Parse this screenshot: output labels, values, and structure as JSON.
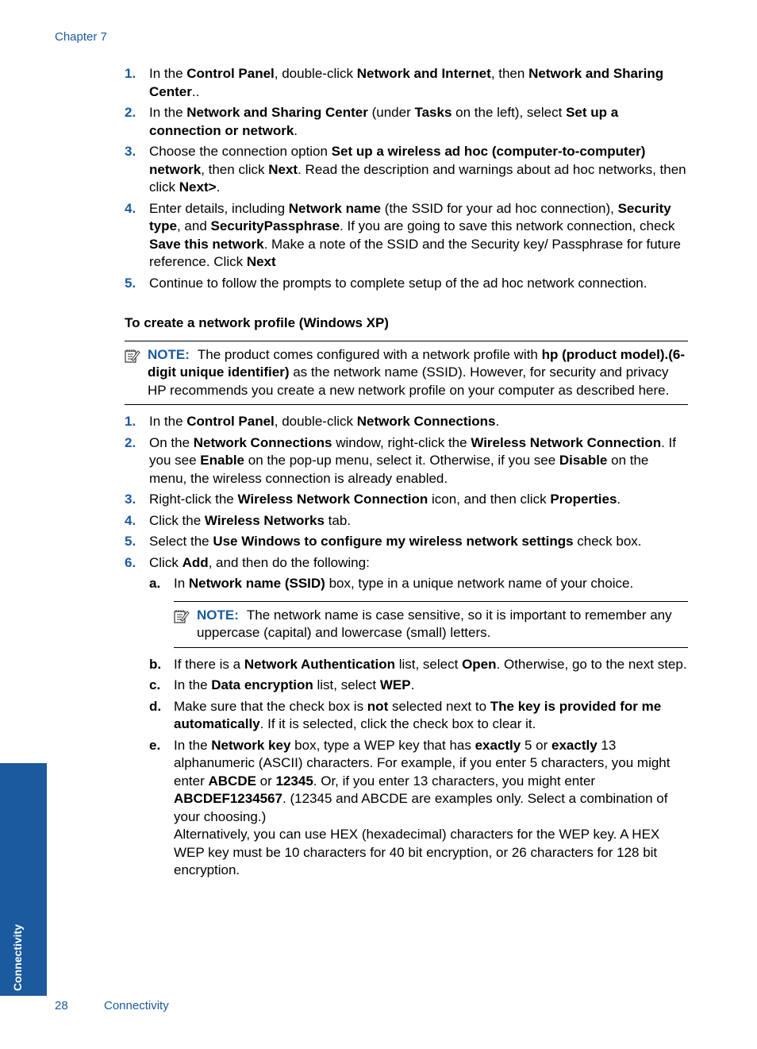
{
  "header": {
    "chapter": "Chapter 7"
  },
  "steps_a": [
    {
      "n": "1.",
      "html": "In the <b>Control Panel</b>, double-click <b>Network and Internet</b>, then <b>Network and Sharing Center</b>.."
    },
    {
      "n": "2.",
      "html": "In the <b>Network and Sharing Center</b> (under <b>Tasks</b> on the left), select <b>Set up a connection or network</b>."
    },
    {
      "n": "3.",
      "html": "Choose the connection option <b>Set up a wireless ad hoc (computer-to-computer) network</b>, then click <b>Next</b>. Read the description and warnings about ad hoc networks, then click <b>Next&gt;</b>."
    },
    {
      "n": "4.",
      "html": "Enter details, including <b>Network name</b> (the SSID for your ad hoc connection), <b>Security type</b>, and <b>SecurityPassphrase</b>. If you are going to save this network connection, check <b>Save this network</b>. Make a note of the SSID and the Security key/ Passphrase for future reference. Click <b>Next</b>"
    },
    {
      "n": "5.",
      "html": "Continue to follow the prompts to complete setup of the ad hoc network connection."
    }
  ],
  "section_heading": "To create a network profile (Windows XP)",
  "note1": {
    "label": "NOTE:",
    "html": "The product comes configured with a network profile with <b>hp (product model).(6-digit unique identifier)</b> as the network name (SSID). However, for security and privacy HP recommends you create a new network profile on your computer as described here."
  },
  "steps_b": [
    {
      "n": "1.",
      "html": "In the <b>Control Panel</b>, double-click <b>Network Connections</b>."
    },
    {
      "n": "2.",
      "html": "On the <b>Network Connections</b> window, right-click the <b>Wireless Network Connection</b>. If you see <b>Enable</b> on the pop-up menu, select it. Otherwise, if you see <b>Disable</b> on the menu, the wireless connection is already enabled."
    },
    {
      "n": "3.",
      "html": "Right-click the <b>Wireless Network Connection</b> icon, and then click <b>Properties</b>."
    },
    {
      "n": "4.",
      "html": "Click the <b>Wireless Networks</b> tab."
    },
    {
      "n": "5.",
      "html": "Select the <b>Use Windows to configure my wireless network settings</b> check box."
    },
    {
      "n": "6.",
      "html": "Click <b>Add</b>, and then do the following:"
    }
  ],
  "substeps": [
    {
      "l": "a.",
      "html": "In <b>Network name (SSID)</b> box, type in a unique network name of your choice."
    },
    {
      "l": "b.",
      "html": "If there is a <b>Network Authentication</b> list, select <b>Open</b>. Otherwise, go to the next step."
    },
    {
      "l": "c.",
      "html": "In the <b>Data encryption</b> list, select <b>WEP</b>."
    },
    {
      "l": "d.",
      "html": "Make sure that the check box is <b>not</b> selected next to <b>The key is provided for me automatically</b>. If it is selected, click the check box to clear it."
    },
    {
      "l": "e.",
      "html": "In the <b>Network key</b> box, type a WEP key that has <b>exactly</b> 5 or <b>exactly</b> 13 alphanumeric (ASCII) characters. For example, if you enter 5 characters, you might enter <b>ABCDE</b> or <b>12345</b>. Or, if you enter 13 characters, you might enter <b>ABCDEF1234567</b>. (12345 and ABCDE are examples only. Select a combination of your choosing.)<br>Alternatively, you can use HEX (hexadecimal) characters for the WEP key. A HEX WEP key must be 10 characters for 40 bit encryption, or 26 characters for 128 bit encryption."
    }
  ],
  "note2": {
    "label": "NOTE:",
    "text": "The network name is case sensitive, so it is important to remember any uppercase (capital) and lowercase (small) letters."
  },
  "sidebar": {
    "tab": "Connectivity"
  },
  "footer": {
    "page": "28",
    "section": "Connectivity"
  }
}
